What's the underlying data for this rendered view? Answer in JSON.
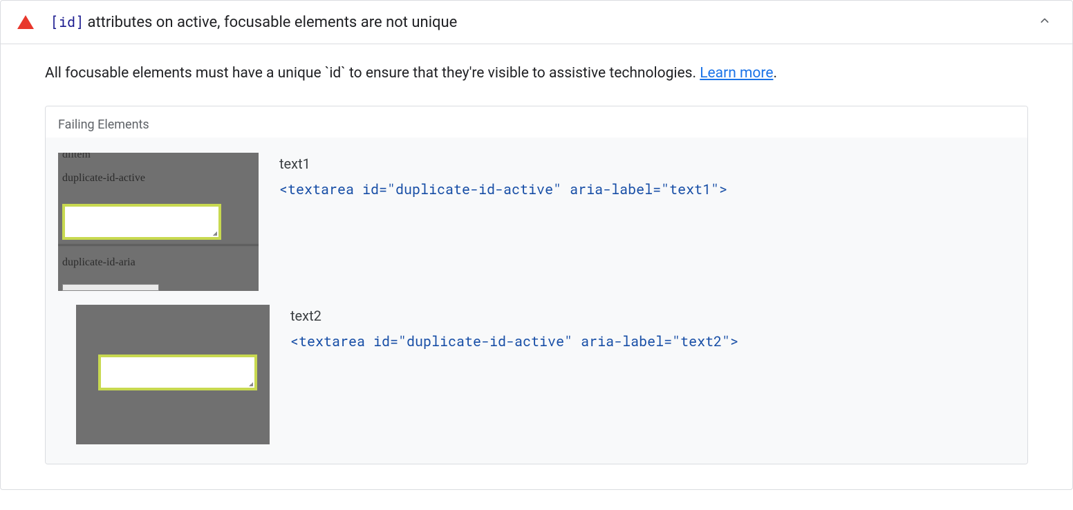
{
  "audit": {
    "title_code": "[id]",
    "title_rest": " attributes on active, focusable elements are not unique",
    "description_pre": "All focusable elements must have a unique ",
    "description_code": "`id`",
    "description_post": " to ensure that they're visible to assistive technologies. ",
    "learn_more": "Learn more",
    "period": "."
  },
  "failing": {
    "header": "Failing Elements",
    "items": [
      {
        "label": "text1",
        "snippet": "<textarea id=\"duplicate-id-active\" aria-label=\"text1\">",
        "thumb": {
          "cut_label": "dlitem",
          "label_top": "duplicate-id-active",
          "label_bottom": "duplicate-id-aria"
        }
      },
      {
        "label": "text2",
        "snippet": "<textarea id=\"duplicate-id-active\" aria-label=\"text2\">",
        "thumb": {}
      }
    ]
  }
}
